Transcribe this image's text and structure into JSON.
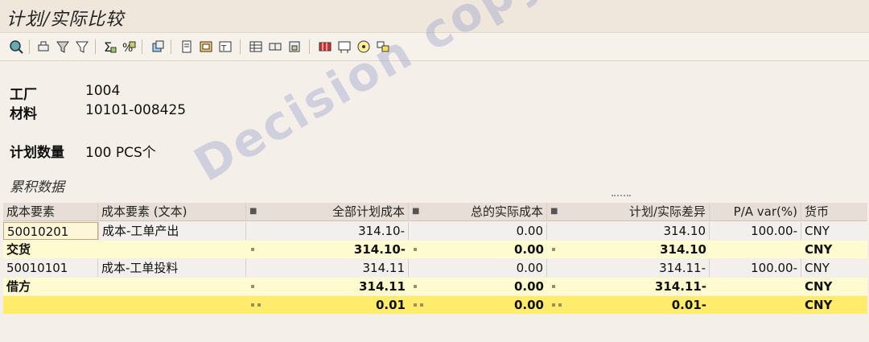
{
  "window": {
    "title": "计划/实际比较"
  },
  "toolbar": {
    "icons": [
      "details-icon",
      "print-icon",
      "filter-icon",
      "set-filter-icon",
      "sum-icon",
      "subtotal-icon",
      "export-icon",
      "local-file-icon",
      "spreadsheet-icon",
      "word-icon",
      "layout-icon",
      "select-layout-icon",
      "save-layout-icon",
      "grid-icon",
      "cost-element-icon",
      "cost-structure-icon",
      "overhead-icon",
      "info-icon"
    ]
  },
  "header": {
    "plant_label": "工厂",
    "plant_value": "1004",
    "material_label": "材料",
    "material_value": "10101-008425",
    "qty_label": "计划数量",
    "qty_value": "100 PCS个"
  },
  "section_title": "累积数据",
  "table": {
    "headers": {
      "cost_element": "成本要素",
      "cost_element_text": "成本要素 (文本)",
      "total_plan": "全部计划成本",
      "total_actual": "总的实际成本",
      "variance": "计划/实际差异",
      "pa_var": "P/A var(%)",
      "currency": "货币"
    },
    "rows": [
      {
        "kind": "item",
        "cost_element": "50010201",
        "text": "成本-工单产出",
        "plan": "314.10-",
        "actual": "0.00",
        "variance": "314.10",
        "pa": "100.00-",
        "currency": "CNY"
      },
      {
        "kind": "subtotal",
        "cost_element": "交货",
        "text": "",
        "plan": "314.10-",
        "actual": "0.00",
        "variance": "314.10",
        "pa": "",
        "currency": "CNY"
      },
      {
        "kind": "item",
        "cost_element": "50010101",
        "text": "成本-工单投料",
        "plan": "314.11",
        "actual": "0.00",
        "variance": "314.11-",
        "pa": "100.00-",
        "currency": "CNY"
      },
      {
        "kind": "subtotal",
        "cost_element": "借方",
        "text": "",
        "plan": "314.11",
        "actual": "0.00",
        "variance": "314.11-",
        "pa": "",
        "currency": "CNY"
      },
      {
        "kind": "total",
        "cost_element": "",
        "text": "",
        "plan": "0.01",
        "actual": "0.00",
        "variance": "0.01-",
        "pa": "",
        "currency": "CNY"
      }
    ]
  },
  "watermark": "Decision copyright",
  "colors": {
    "subtotal": "#fffbd1",
    "total": "#ffeb6c",
    "header": "#e7dfd7"
  }
}
